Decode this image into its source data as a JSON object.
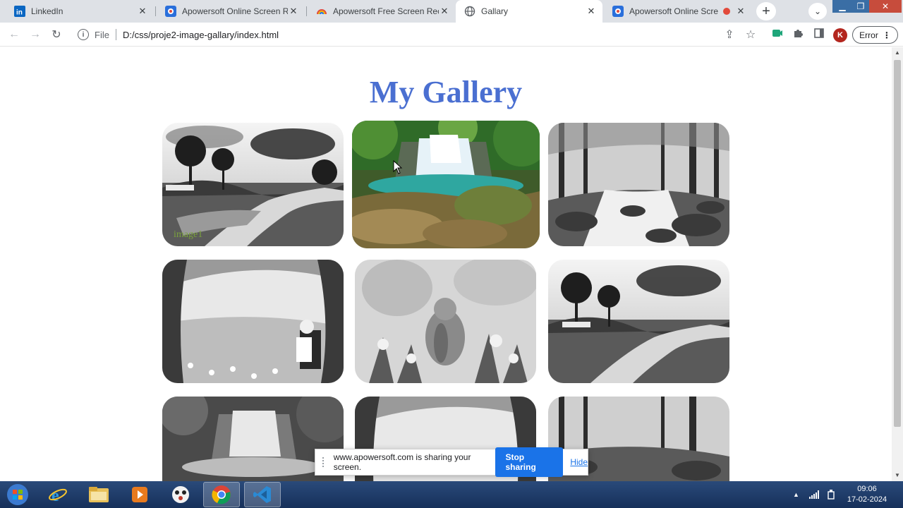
{
  "browser": {
    "tabs": [
      {
        "title": "LinkedIn",
        "active": false
      },
      {
        "title": "Apowersoft Online Screen Rec",
        "active": false
      },
      {
        "title": "Apowersoft Free Screen Recor",
        "active": false
      },
      {
        "title": "Gallary",
        "active": true
      },
      {
        "title": "Apowersoft Online Screen",
        "active": false
      }
    ],
    "address": {
      "scheme_label": "File",
      "url": "D:/css/proje2-image-gallary/index.html"
    },
    "profile_initial": "K",
    "error_label": "Error"
  },
  "page": {
    "title": "My Gallery",
    "images": [
      {
        "caption": "image1",
        "tone": "gray",
        "scene": "river-park"
      },
      {
        "caption": "",
        "tone": "color",
        "scene": "waterfall"
      },
      {
        "caption": "",
        "tone": "gray",
        "scene": "forest-stream"
      },
      {
        "caption": "",
        "tone": "gray",
        "scene": "girl-meadow"
      },
      {
        "caption": "",
        "tone": "gray",
        "scene": "chipmunk-flowers"
      },
      {
        "caption": "",
        "tone": "gray",
        "scene": "river-park"
      },
      {
        "caption": "",
        "tone": "gray",
        "scene": "waterfall"
      },
      {
        "caption": "",
        "tone": "gray",
        "scene": "girl-meadow"
      },
      {
        "caption": "",
        "tone": "gray",
        "scene": "forest-stream"
      }
    ]
  },
  "sharebar": {
    "message": "www.apowersoft.com is sharing your screen.",
    "stop_label": "Stop sharing",
    "hide_label": "Hide"
  },
  "taskbar": {
    "apps": [
      "start-orb",
      "internet-explorer",
      "file-explorer",
      "media-player",
      "paint-app",
      "chrome",
      "vscode"
    ],
    "active_app": "chrome",
    "time": "09:06",
    "date": "17-02-2024"
  },
  "colors": {
    "title_blue": "#4a6fd1",
    "tab_strip": "#dee1e6",
    "stop_button": "#1a73e8",
    "caption_green": "#7aa23c"
  }
}
